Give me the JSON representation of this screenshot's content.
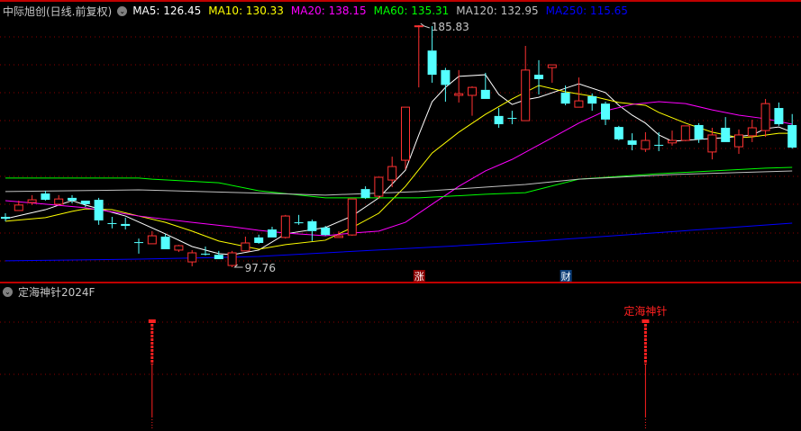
{
  "header": {
    "title": "中际旭创(日线.前复权)",
    "toggle_icon": "chevron-down-circle-icon",
    "ma_labels": [
      {
        "text": "MA5: 126.45",
        "color": "#ffffff"
      },
      {
        "text": "MA10: 130.33",
        "color": "#ffff00"
      },
      {
        "text": "MA20: 138.15",
        "color": "#ff00ff"
      },
      {
        "text": "MA60: 135.31",
        "color": "#00ff00"
      },
      {
        "text": "MA120: 132.95",
        "color": "#c0c0c0"
      },
      {
        "text": "MA250: 115.65",
        "color": "#0000ff"
      }
    ]
  },
  "indicator": {
    "title": "定海神针2024F",
    "signal_label": "定海神针",
    "signal_indices": [
      11,
      48
    ],
    "labeled_index": 48,
    "color": "#ff2020"
  },
  "colors": {
    "up": "#ff3232",
    "down": "#54ffff",
    "grid": "#8b0000",
    "border": "#c00000"
  },
  "chart_data": {
    "type": "candlestick",
    "title": "中际旭创(日线.前复权)",
    "price_range": [
      97.76,
      185.83
    ],
    "grid": true,
    "candle_fields": [
      "open",
      "high",
      "low",
      "close"
    ],
    "candles": [
      [
        116.1,
        117.4,
        114.5,
        115.4
      ],
      [
        118.4,
        122.0,
        118.4,
        120.4
      ],
      [
        121.3,
        124.0,
        120.4,
        122.3
      ],
      [
        124.6,
        125.6,
        122.0,
        122.3
      ],
      [
        120.7,
        124.0,
        120.7,
        122.6
      ],
      [
        123.0,
        124.0,
        121.0,
        122.0
      ],
      [
        122.0,
        122.0,
        119.7,
        120.7
      ],
      [
        122.3,
        123.0,
        113.2,
        114.8
      ],
      [
        113.8,
        116.1,
        111.9,
        113.6
      ],
      [
        113.5,
        115.8,
        111.5,
        112.8
      ],
      [
        106.9,
        108.2,
        102.7,
        106.8
      ],
      [
        106.3,
        110.9,
        106.3,
        109.2
      ],
      [
        108.9,
        109.9,
        104.3,
        104.3
      ],
      [
        104.0,
        105.9,
        103.3,
        105.6
      ],
      [
        99.7,
        104.0,
        98.1,
        103.0
      ],
      [
        102.7,
        105.3,
        102.0,
        102.5
      ],
      [
        102.3,
        103.7,
        100.7,
        100.7
      ],
      [
        98.4,
        103.7,
        97.76,
        103.0
      ],
      [
        103.7,
        108.9,
        103.7,
        106.6
      ],
      [
        108.6,
        109.6,
        106.3,
        106.6
      ],
      [
        111.5,
        112.5,
        108.6,
        108.6
      ],
      [
        108.6,
        116.8,
        108.2,
        116.4
      ],
      [
        114.1,
        116.8,
        113.2,
        114.0
      ],
      [
        114.5,
        115.1,
        107.3,
        110.9
      ],
      [
        112.2,
        112.8,
        109.2,
        109.5
      ],
      [
        108.6,
        110.9,
        108.6,
        109.2
      ],
      [
        109.5,
        122.6,
        109.2,
        122.6
      ],
      [
        126.2,
        127.2,
        122.6,
        123.0
      ],
      [
        123.6,
        130.5,
        122.6,
        130.5
      ],
      [
        129.5,
        138.0,
        126.9,
        134.4
      ],
      [
        136.7,
        156.0,
        133.4,
        156.0
      ],
      [
        185.6,
        185.83,
        163.2,
        185.6
      ],
      [
        176.6,
        185.5,
        164.9,
        167.8
      ],
      [
        169.5,
        170.3,
        158.0,
        164.1
      ],
      [
        160.3,
        169.5,
        157.7,
        160.9
      ],
      [
        160.3,
        163.6,
        152.9,
        163.2
      ],
      [
        162.3,
        168.5,
        159.0,
        159.0
      ],
      [
        152.8,
        155.7,
        148.5,
        149.8
      ],
      [
        152.1,
        154.7,
        149.8,
        151.8
      ],
      [
        151.1,
        178.3,
        151.1,
        169.5
      ],
      [
        167.8,
        173.1,
        160.6,
        166.2
      ],
      [
        170.4,
        171.4,
        164.9,
        171.4
      ],
      [
        161.3,
        163.9,
        156.7,
        157.3
      ],
      [
        156.0,
        166.8,
        156.0,
        158.3
      ],
      [
        160.0,
        161.0,
        154.7,
        157.3
      ],
      [
        157.3,
        158.0,
        149.5,
        151.5
      ],
      [
        148.8,
        149.2,
        143.9,
        144.3
      ],
      [
        143.9,
        146.5,
        140.3,
        142.3
      ],
      [
        140.7,
        146.9,
        139.7,
        143.9
      ],
      [
        142.3,
        146.9,
        140.0,
        142.0
      ],
      [
        143.0,
        147.5,
        142.0,
        143.9
      ],
      [
        143.9,
        149.2,
        143.6,
        149.2
      ],
      [
        149.5,
        150.2,
        143.0,
        144.3
      ],
      [
        139.7,
        148.5,
        137.0,
        145.9
      ],
      [
        148.5,
        152.4,
        143.3,
        143.3
      ],
      [
        141.6,
        147.9,
        139.0,
        145.9
      ],
      [
        145.6,
        151.4,
        143.3,
        148.5
      ],
      [
        147.5,
        159.0,
        145.2,
        157.3
      ],
      [
        155.7,
        157.7,
        149.2,
        149.8
      ],
      [
        149.5,
        153.5,
        140.9,
        141.3
      ]
    ],
    "ma_lines": [
      {
        "name": "MA5",
        "color": "#ffffff",
        "points": [
          [
            0,
            115.4
          ],
          [
            3,
            118.7
          ],
          [
            5,
            122.0
          ],
          [
            6,
            120.4
          ],
          [
            9,
            116.4
          ],
          [
            12,
            109.9
          ],
          [
            14,
            105.3
          ],
          [
            16,
            102.7
          ],
          [
            17,
            102.3
          ],
          [
            19,
            104.0
          ],
          [
            21,
            109.9
          ],
          [
            24,
            112.2
          ],
          [
            26,
            116.4
          ],
          [
            28,
            123.0
          ],
          [
            30,
            133.1
          ],
          [
            31,
            145.9
          ],
          [
            32,
            158.0
          ],
          [
            33,
            163.2
          ],
          [
            34,
            167.2
          ],
          [
            36,
            167.8
          ],
          [
            37,
            160.6
          ],
          [
            38,
            157.0
          ],
          [
            39,
            158.7
          ],
          [
            40,
            159.6
          ],
          [
            42,
            162.9
          ],
          [
            43,
            164.5
          ],
          [
            45,
            161.3
          ],
          [
            46,
            156.7
          ],
          [
            47,
            153.1
          ],
          [
            48,
            150.2
          ],
          [
            49,
            145.9
          ],
          [
            50,
            143.6
          ],
          [
            52,
            144.3
          ],
          [
            54,
            144.9
          ],
          [
            56,
            145.9
          ],
          [
            57,
            148.2
          ],
          [
            58,
            148.8
          ],
          [
            59,
            146.9
          ]
        ]
      },
      {
        "name": "MA10",
        "color": "#ffff00",
        "points": [
          [
            0,
            114.5
          ],
          [
            3,
            115.8
          ],
          [
            5,
            118.1
          ],
          [
            6,
            119.0
          ],
          [
            8,
            118.7
          ],
          [
            10,
            116.4
          ],
          [
            12,
            114.1
          ],
          [
            14,
            110.9
          ],
          [
            16,
            107.3
          ],
          [
            18,
            105.3
          ],
          [
            19,
            104.3
          ],
          [
            21,
            106.0
          ],
          [
            24,
            107.6
          ],
          [
            26,
            112.2
          ],
          [
            28,
            117.4
          ],
          [
            30,
            127.2
          ],
          [
            32,
            139.3
          ],
          [
            34,
            146.9
          ],
          [
            36,
            153.4
          ],
          [
            38,
            159.0
          ],
          [
            40,
            163.9
          ],
          [
            42,
            161.6
          ],
          [
            44,
            160.0
          ],
          [
            46,
            157.7
          ],
          [
            48,
            156.7
          ],
          [
            49,
            154.1
          ],
          [
            51,
            150.2
          ],
          [
            53,
            146.9
          ],
          [
            55,
            144.9
          ],
          [
            56,
            145.2
          ],
          [
            58,
            146.5
          ],
          [
            59,
            146.5
          ]
        ]
      },
      {
        "name": "MA20",
        "color": "#ff00ff",
        "points": [
          [
            0,
            122.0
          ],
          [
            3,
            120.7
          ],
          [
            6,
            119.4
          ],
          [
            10,
            116.4
          ],
          [
            14,
            114.1
          ],
          [
            17,
            112.5
          ],
          [
            19,
            111.2
          ],
          [
            21,
            110.2
          ],
          [
            24,
            109.2
          ],
          [
            26,
            110.2
          ],
          [
            28,
            110.9
          ],
          [
            30,
            114.1
          ],
          [
            32,
            120.7
          ],
          [
            34,
            127.2
          ],
          [
            36,
            132.8
          ],
          [
            38,
            137.0
          ],
          [
            41,
            144.9
          ],
          [
            43,
            150.2
          ],
          [
            45,
            154.7
          ],
          [
            47,
            157.0
          ],
          [
            49,
            158.0
          ],
          [
            51,
            157.3
          ],
          [
            53,
            155.0
          ],
          [
            55,
            153.1
          ],
          [
            57,
            151.8
          ],
          [
            59,
            149.8
          ]
        ]
      },
      {
        "name": "MA60",
        "color": "#00ff00",
        "points": [
          [
            0,
            130.2
          ],
          [
            10,
            130.2
          ],
          [
            11,
            129.8
          ],
          [
            16,
            128.5
          ],
          [
            19,
            125.6
          ],
          [
            24,
            123.0
          ],
          [
            28,
            123.0
          ],
          [
            31,
            123.0
          ],
          [
            36,
            124.3
          ],
          [
            39,
            124.9
          ],
          [
            43,
            129.8
          ],
          [
            49,
            131.8
          ],
          [
            53,
            132.8
          ],
          [
            57,
            133.8
          ],
          [
            59,
            134.1
          ]
        ]
      },
      {
        "name": "MA120",
        "color": "#c0c0c0",
        "points": [
          [
            0,
            125.3
          ],
          [
            10,
            125.9
          ],
          [
            20,
            124.6
          ],
          [
            24,
            124.0
          ],
          [
            31,
            125.3
          ],
          [
            39,
            127.9
          ],
          [
            43,
            129.8
          ],
          [
            50,
            131.5
          ],
          [
            57,
            132.5
          ],
          [
            59,
            132.8
          ]
        ]
      },
      {
        "name": "MA250",
        "color": "#0000ff",
        "points": [
          [
            0,
            100.1
          ],
          [
            10,
            100.7
          ],
          [
            17,
            101.4
          ],
          [
            19,
            101.7
          ],
          [
            34,
            105.6
          ],
          [
            40,
            107.3
          ],
          [
            59,
            113.8
          ]
        ]
      }
    ],
    "annotations": {
      "high": {
        "index": 31,
        "text": "185.83"
      },
      "low": {
        "index": 17,
        "text": "97.76"
      },
      "markers": [
        {
          "index": 31,
          "text": "涨",
          "bg": "#8b0000"
        },
        {
          "index": 42,
          "text": "财",
          "bg": "#0d3f7a"
        }
      ]
    }
  }
}
